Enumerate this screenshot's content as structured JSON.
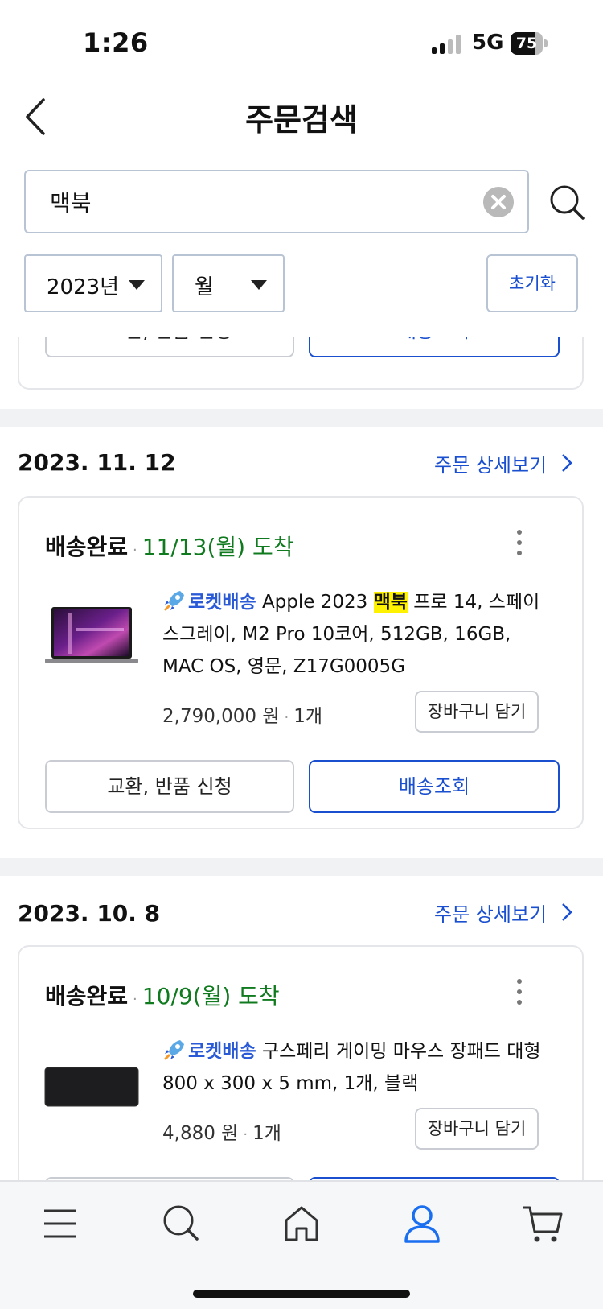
{
  "status_bar": {
    "time": "1:26",
    "network": "5G",
    "battery": "75"
  },
  "header": {
    "title": "주문검색"
  },
  "search": {
    "value": "맥북",
    "placeholder": ""
  },
  "filters": {
    "year": "2023년",
    "month": "월",
    "reset": "초기화"
  },
  "partial_card": {
    "left_button": "교환, 반품 신청",
    "right_button": "배송조회"
  },
  "orders": [
    {
      "date": "2023. 11. 12",
      "detail_link": "주문 상세보기",
      "status": "배송완료",
      "arrival": "11/13(월) 도착",
      "rocket_label": "로켓배송",
      "name_before": "Apple 2023 ",
      "name_highlight": "맥북",
      "name_after": " 프로 14, 스페이스그레이, M2 Pro 10코어, 512GB, 16GB, MAC OS, 영문, Z17G0005G",
      "price": "2,790,000 원",
      "quantity": "1개",
      "cart_button": "장바구니 담기",
      "left_button": "교환, 반품 신청",
      "right_button": "배송조회"
    },
    {
      "date": "2023. 10. 8",
      "detail_link": "주문 상세보기",
      "status": "배송완료",
      "arrival": "10/9(월) 도착",
      "rocket_label": "로켓배송",
      "name": " 구스페리 게이밍 마우스 장패드 대형 800 x 300 x 5 mm, 1개, 블랙",
      "price": "4,880 원",
      "quantity": "1개",
      "cart_button": "장바구니 담기"
    }
  ],
  "tab_bar": {
    "icons": [
      "menu-icon",
      "search-icon",
      "home-icon",
      "my-coupang-icon",
      "cart-icon"
    ],
    "active": "my-coupang-icon"
  },
  "colors": {
    "accent": "#1a4fd0",
    "arrival": "#0f7a1e",
    "highlight": "#fff200",
    "card_border": "#e4e6ea"
  }
}
